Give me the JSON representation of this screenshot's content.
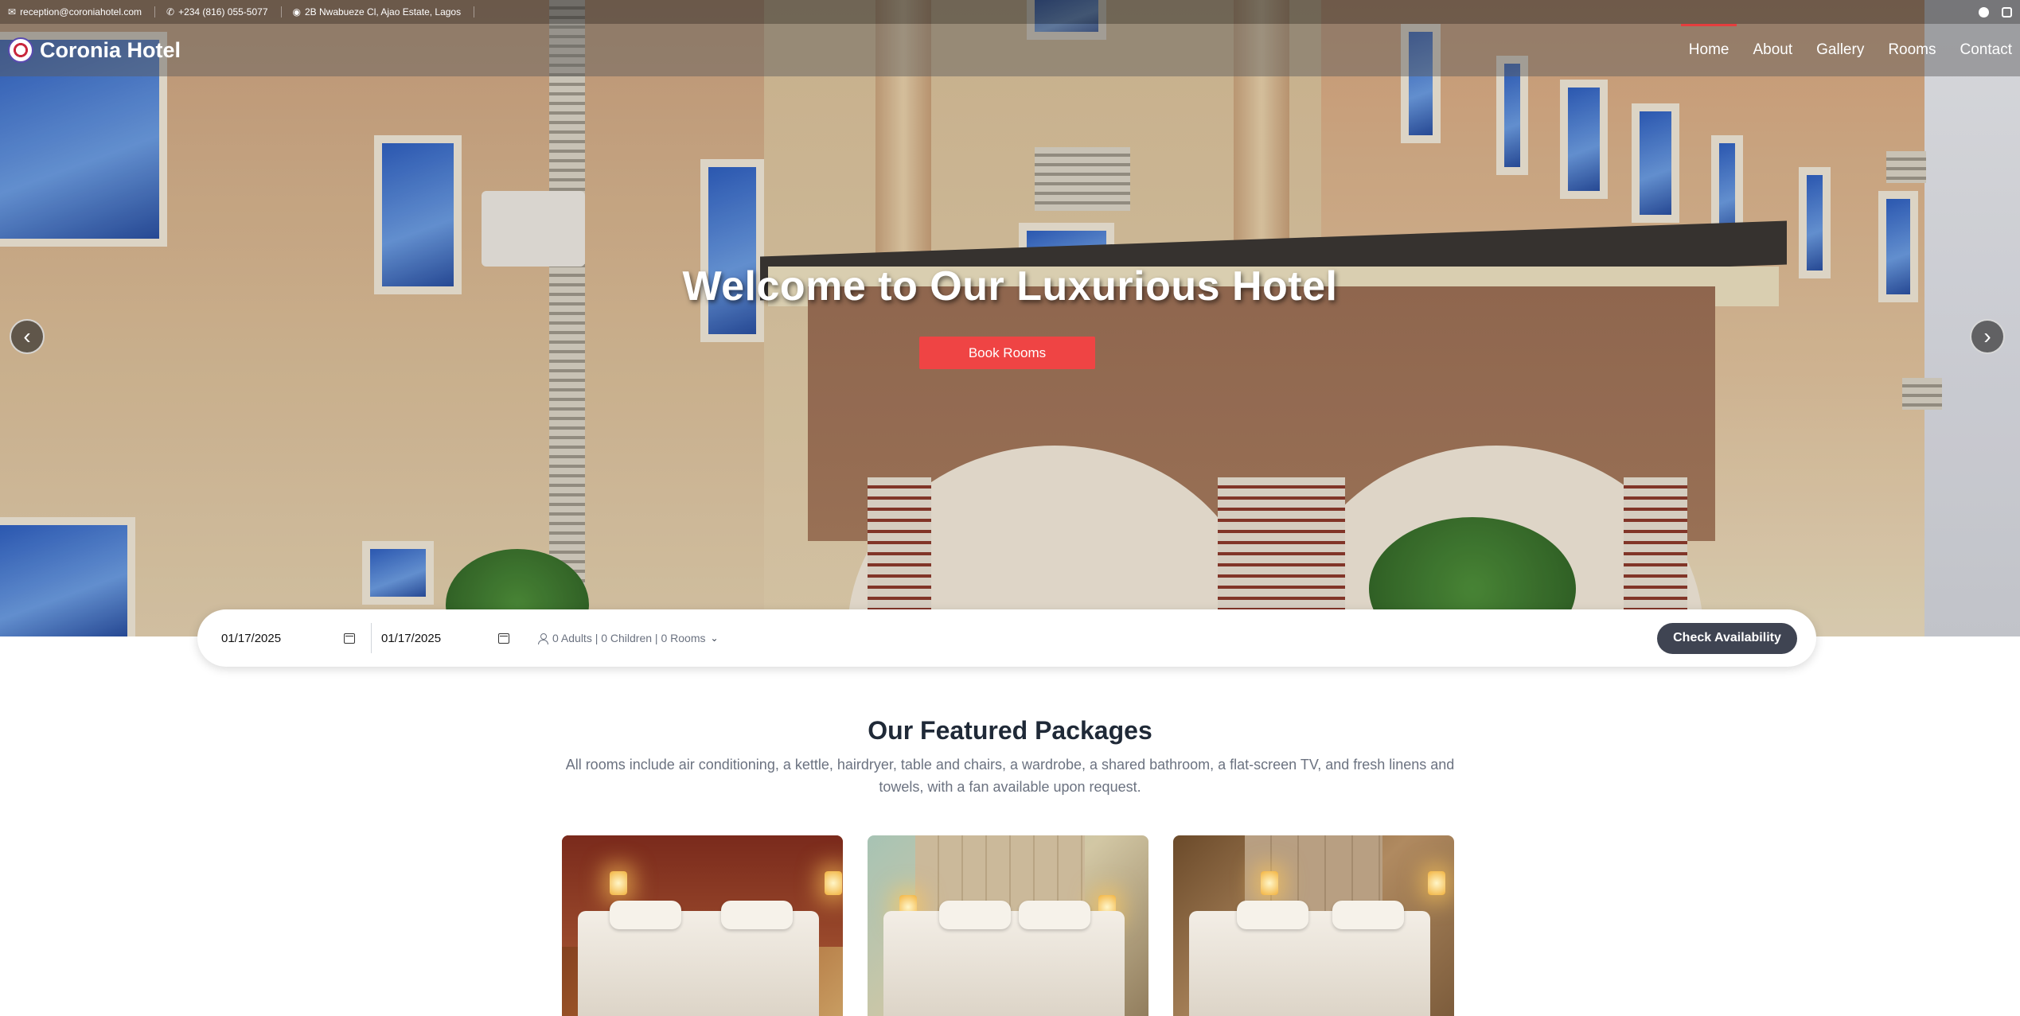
{
  "topbar": {
    "email": "reception@coroniahotel.com",
    "phone": "+234 (816) 055-5077",
    "address": "2B Nwabueze Cl, Ajao Estate, Lagos",
    "icons": [
      "mail-icon",
      "phone-icon",
      "map-pin-icon",
      "facebook-icon",
      "instagram-icon"
    ]
  },
  "nav": {
    "brand": "Coronia Hotel",
    "items": [
      {
        "label": "Home",
        "active": true
      },
      {
        "label": "About",
        "active": false
      },
      {
        "label": "Gallery",
        "active": false
      },
      {
        "label": "Rooms",
        "active": false
      },
      {
        "label": "Contact",
        "active": false
      }
    ]
  },
  "hero": {
    "title": "Welcome to Our Luxurious Hotel",
    "cta_label": "Book Rooms",
    "prev_icon": "chevron-left-icon",
    "next_icon": "chevron-right-icon"
  },
  "booking": {
    "check_in": "01/17/2025",
    "check_out": "01/17/2025",
    "guests_summary": "0 Adults | 0 Children | 0 Rooms",
    "submit_label": "Check Availability"
  },
  "featured": {
    "title": "Our Featured Packages",
    "description": "All rooms include air conditioning, a kettle, hairdryer, table and chairs, a wardrobe, a shared bathroom, a flat-screen TV, and fresh linens and towels, with a fan available upon request."
  },
  "colors": {
    "accent": "#ef4444",
    "dark_button": "#3f4452",
    "heading": "#1f2937",
    "muted_text": "#6b7280"
  }
}
